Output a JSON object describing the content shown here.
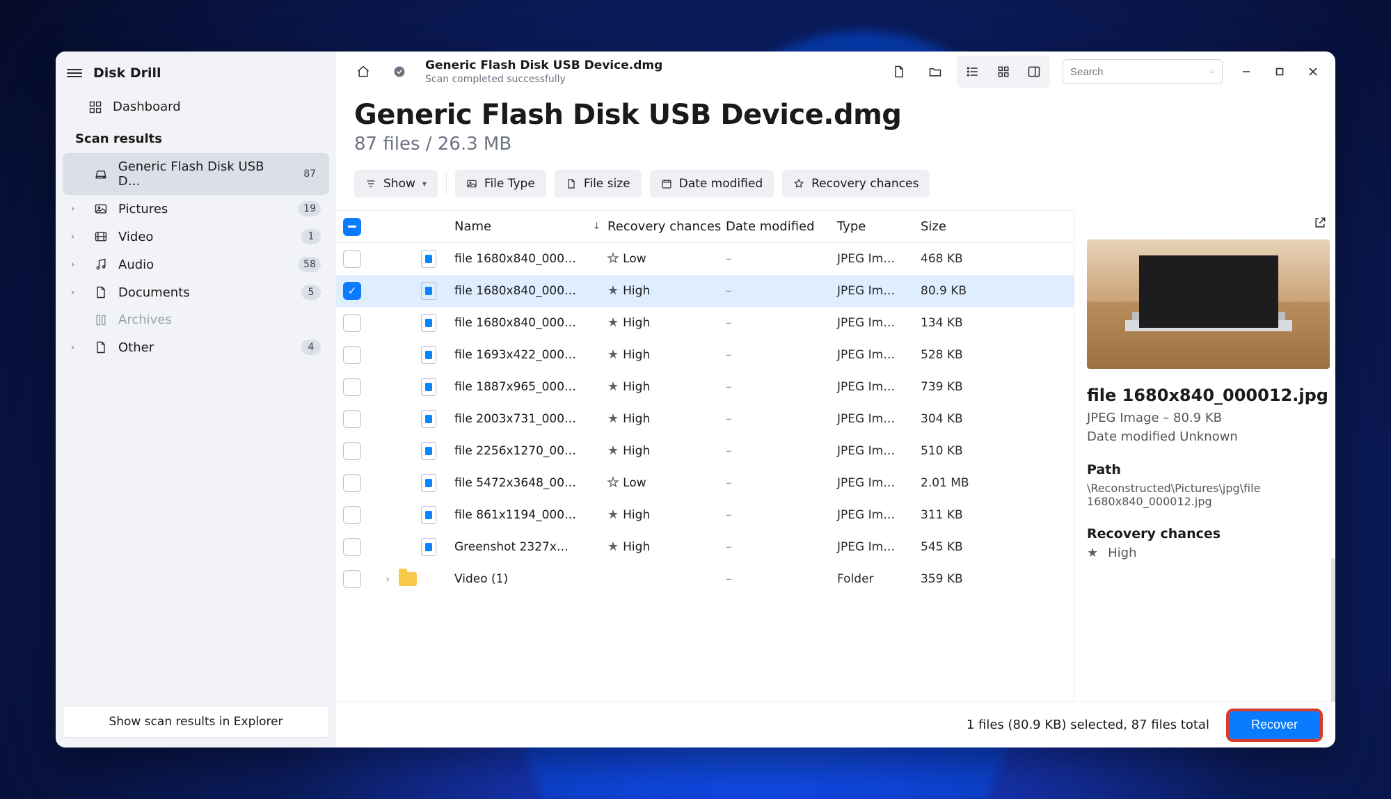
{
  "app": {
    "name": "Disk Drill"
  },
  "sidebar": {
    "dashboard_label": "Dashboard",
    "section_label": "Scan results",
    "items": [
      {
        "label": "Generic Flash Disk USB D…",
        "count": "87",
        "icon": "drive",
        "active": true,
        "expandable": false
      },
      {
        "label": "Pictures",
        "count": "19",
        "icon": "picture",
        "active": false,
        "expandable": true
      },
      {
        "label": "Video",
        "count": "1",
        "icon": "video",
        "active": false,
        "expandable": true
      },
      {
        "label": "Audio",
        "count": "58",
        "icon": "audio",
        "active": false,
        "expandable": true
      },
      {
        "label": "Documents",
        "count": "5",
        "icon": "document",
        "active": false,
        "expandable": true
      },
      {
        "label": "Archives",
        "count": "",
        "icon": "archive",
        "active": false,
        "expandable": false,
        "disabled": true
      },
      {
        "label": "Other",
        "count": "4",
        "icon": "other",
        "active": false,
        "expandable": true
      }
    ],
    "footer_button": "Show scan results in Explorer"
  },
  "topbar": {
    "breadcrumb_title": "Generic Flash Disk USB Device.dmg",
    "breadcrumb_sub": "Scan completed successfully",
    "search_placeholder": "Search"
  },
  "page": {
    "title": "Generic Flash Disk USB Device.dmg",
    "subtitle": "87 files / 26.3 MB"
  },
  "filters": {
    "show": "Show",
    "file_type": "File Type",
    "file_size": "File size",
    "date_modified": "Date modified",
    "recovery_chances": "Recovery chances"
  },
  "columns": {
    "name": "Name",
    "recovery": "Recovery chances",
    "date": "Date modified",
    "type": "Type",
    "size": "Size"
  },
  "rows": [
    {
      "name": "file 1680x840_000…",
      "chance": "Low",
      "chance_solid": false,
      "date": "–",
      "type": "JPEG Im…",
      "size": "468 KB",
      "selected": false,
      "kind": "file"
    },
    {
      "name": "file 1680x840_000…",
      "chance": "High",
      "chance_solid": true,
      "date": "–",
      "type": "JPEG Im…",
      "size": "80.9 KB",
      "selected": true,
      "kind": "file"
    },
    {
      "name": "file 1680x840_000…",
      "chance": "High",
      "chance_solid": true,
      "date": "–",
      "type": "JPEG Im…",
      "size": "134 KB",
      "selected": false,
      "kind": "file"
    },
    {
      "name": "file 1693x422_000…",
      "chance": "High",
      "chance_solid": true,
      "date": "–",
      "type": "JPEG Im…",
      "size": "528 KB",
      "selected": false,
      "kind": "file"
    },
    {
      "name": "file 1887x965_000…",
      "chance": "High",
      "chance_solid": true,
      "date": "–",
      "type": "JPEG Im…",
      "size": "739 KB",
      "selected": false,
      "kind": "file"
    },
    {
      "name": "file 2003x731_000…",
      "chance": "High",
      "chance_solid": true,
      "date": "–",
      "type": "JPEG Im…",
      "size": "304 KB",
      "selected": false,
      "kind": "file"
    },
    {
      "name": "file 2256x1270_00…",
      "chance": "High",
      "chance_solid": true,
      "date": "–",
      "type": "JPEG Im…",
      "size": "510 KB",
      "selected": false,
      "kind": "file"
    },
    {
      "name": "file 5472x3648_00…",
      "chance": "Low",
      "chance_solid": false,
      "date": "–",
      "type": "JPEG Im…",
      "size": "2.01 MB",
      "selected": false,
      "kind": "file"
    },
    {
      "name": "file 861x1194_000…",
      "chance": "High",
      "chance_solid": true,
      "date": "–",
      "type": "JPEG Im…",
      "size": "311 KB",
      "selected": false,
      "kind": "file"
    },
    {
      "name": "Greenshot 2327x…",
      "chance": "High",
      "chance_solid": true,
      "date": "–",
      "type": "JPEG Im…",
      "size": "545 KB",
      "selected": false,
      "kind": "file"
    },
    {
      "name": "Video (1)",
      "chance": "",
      "chance_solid": false,
      "date": "–",
      "type": "Folder",
      "size": "359 KB",
      "selected": false,
      "kind": "folder"
    }
  ],
  "preview": {
    "filename": "file 1680x840_000012.jpg",
    "meta": "JPEG Image – 80.9 KB",
    "date": "Date modified Unknown",
    "path_label": "Path",
    "path": "\\Reconstructed\\Pictures\\jpg\\file 1680x840_000012.jpg",
    "rc_label": "Recovery chances",
    "rc_value": "High"
  },
  "footer": {
    "status": "1 files (80.9 KB) selected, 87 files total",
    "recover": "Recover"
  }
}
